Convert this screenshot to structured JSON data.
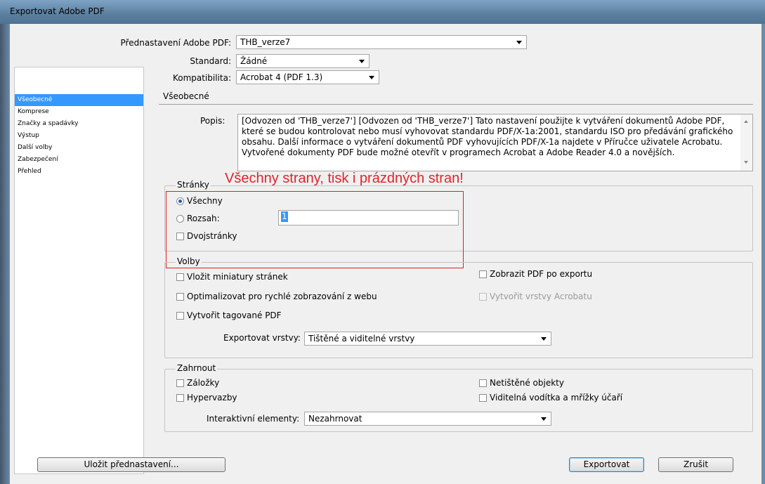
{
  "window": {
    "title": "Exportovat Adobe PDF"
  },
  "top": {
    "preset_label": "Přednastavení Adobe PDF:",
    "preset_value": "THB_verze7",
    "standard_label": "Standard:",
    "standard_value": "Žádné",
    "compat_label": "Kompatibilita:",
    "compat_value": "Acrobat 4 (PDF 1.3)"
  },
  "sidebar": {
    "items": [
      {
        "label": "Všeobecné",
        "selected": true
      },
      {
        "label": "Komprese"
      },
      {
        "label": "Značky a spadávky"
      },
      {
        "label": "Výstup"
      },
      {
        "label": "Další volby"
      },
      {
        "label": "Zabezpečení"
      },
      {
        "label": "Přehled"
      }
    ]
  },
  "main": {
    "section_title": "Všeobecné",
    "description_label": "Popis:",
    "description_text": "[Odvozen od 'THB_verze7'] [Odvozen od 'THB_verze7'] Tato nastavení použijte k vytváření dokumentů Adobe PDF, které se budou kontrolovat nebo musí vyhovovat standardu PDF/X-1a:2001, standardu ISO pro předávání grafického obsahu.  Další informace o vytváření dokumentů PDF vyhovujících PDF/X-1a najdete v Příručce uživatele Acrobatu.  Vytvořené dokumenty PDF bude možné otevřít v programech Acrobat a Adobe Reader 4.0 a novějších.",
    "annotation": "Všechny strany, tisk i prázdných stran!",
    "pages": {
      "title": "Stránky",
      "all_label": "Všechny",
      "range_label": "Rozsah:",
      "range_value": "1",
      "spreads_label": "Dvojstránky"
    },
    "options": {
      "title": "Volby",
      "thumbnails": "Vložit miniatury stránek",
      "optimize": "Optimalizovat pro rychlé zobrazování z webu",
      "tagged": "Vytvořit tagované PDF",
      "view_after": "Zobrazit PDF po exportu",
      "acrobat_layers": "Vytvořit vrstvy Acrobatu",
      "export_layers_label": "Exportovat vrstvy:",
      "export_layers_value": "Tištěné a viditelné vrstvy"
    },
    "include": {
      "title": "Zahrnout",
      "bookmarks": "Záložky",
      "hyperlinks": "Hypervazby",
      "nonprinting": "Netištěné objekty",
      "guides": "Viditelná vodítka a mřížky účaří",
      "interactive_label": "Interaktivní elementy:",
      "interactive_value": "Nezahrnovat"
    }
  },
  "buttons": {
    "save_preset": "Uložit přednastavení...",
    "export": "Exportovat",
    "cancel": "Zrušit"
  },
  "colors": {
    "accent": "#3399ff",
    "annotation": "#e0242c"
  }
}
